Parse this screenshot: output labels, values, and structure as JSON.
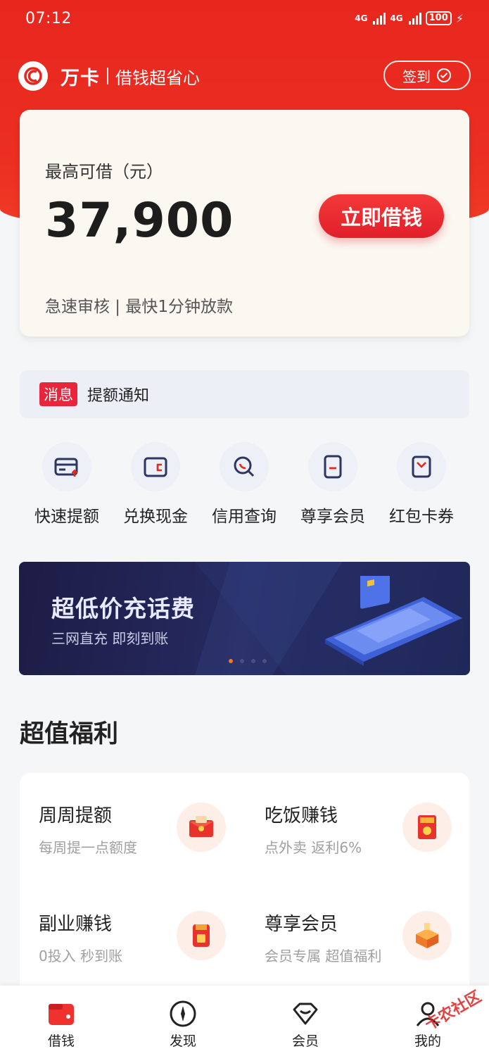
{
  "status_bar": {
    "time": "07:12",
    "network_1": "4G",
    "network_2": "4G",
    "battery": "100"
  },
  "header": {
    "brand": "万卡",
    "slogan": "借钱超省心",
    "checkin_label": "签到"
  },
  "loan_card": {
    "label": "最高可借（元）",
    "amount": "37,900",
    "button_label": "立即借钱",
    "subtitle": "急速审核 | 最快1分钟放款"
  },
  "notice": {
    "tag": "消息",
    "text": "提额通知"
  },
  "quick_actions": [
    {
      "label": "快速提额",
      "icon": "credit-card-up-icon"
    },
    {
      "label": "兑换现金",
      "icon": "wallet-icon"
    },
    {
      "label": "信用查询",
      "icon": "search-icon"
    },
    {
      "label": "尊享会员",
      "icon": "member-card-icon"
    },
    {
      "label": "红包卡券",
      "icon": "coupon-icon"
    }
  ],
  "banner": {
    "title": "超低价充话费",
    "subtitle": "三网直充 即刻到账",
    "page_count": 4,
    "active_page": 1
  },
  "welfare": {
    "title": "超值福利",
    "items": [
      {
        "title": "周周提额",
        "subtitle": "每周提一点额度",
        "icon": "red-envelope-icon"
      },
      {
        "title": "吃饭赚钱",
        "subtitle": "点外卖 返利6%",
        "icon": "food-coupon-icon"
      },
      {
        "title": "副业赚钱",
        "subtitle": "0投入 秒到账",
        "icon": "money-bag-icon"
      },
      {
        "title": "尊享会员",
        "subtitle": "会员专属 超值福利",
        "icon": "vip-gift-icon"
      }
    ]
  },
  "tabbar": {
    "items": [
      {
        "label": "借钱",
        "icon": "wallet-icon",
        "active": true
      },
      {
        "label": "发现",
        "icon": "compass-icon",
        "active": false
      },
      {
        "label": "会员",
        "icon": "diamond-icon",
        "active": false
      },
      {
        "label": "我的",
        "icon": "user-icon",
        "active": false
      }
    ]
  },
  "watermark": "卡农社区",
  "colors": {
    "primary_red": "#e7261e",
    "button_red": "#e21f2b",
    "banner_bg": "#1d1c45"
  }
}
